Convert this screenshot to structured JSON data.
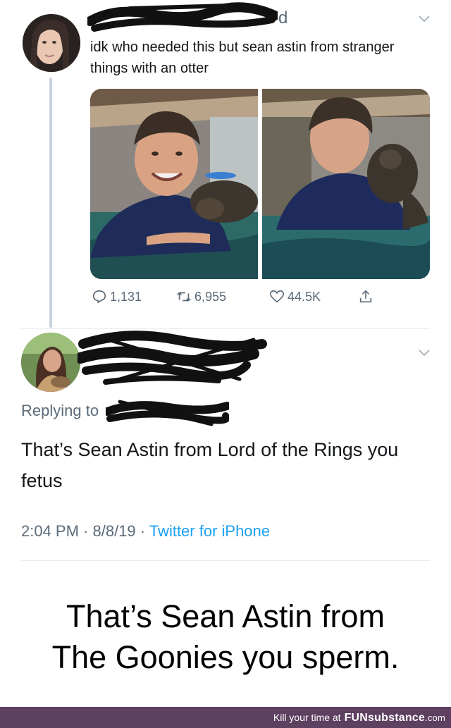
{
  "tweet1": {
    "handle_tail": "d",
    "text": "idk who needed this but sean astin from stranger things with an otter",
    "actions": {
      "replies": "1,131",
      "retweets": "6,955",
      "likes": "44.5K"
    }
  },
  "tweet2": {
    "replying_prefix": "Replying to",
    "text": "That’s Sean Astin from Lord of the Rings you fetus",
    "time": "2:04 PM",
    "date": "8/8/19",
    "separator": " · ",
    "app": "Twitter for iPhone"
  },
  "caption": {
    "line1": "That’s Sean Astin from",
    "line2": "The Goonies you sperm."
  },
  "footer": {
    "prefix": "Kill your time at",
    "brand_main": "FUNsubstance",
    "brand_domain": ".com",
    "background": "#5e4060"
  },
  "icons": [
    "reply-icon",
    "retweet-icon",
    "like-icon",
    "share-icon",
    "chevron-down-icon"
  ],
  "colors": {
    "text": "#14171a",
    "muted": "#5b6a78",
    "link": "#1da1f2",
    "thread_line": "#c8d4e0"
  }
}
